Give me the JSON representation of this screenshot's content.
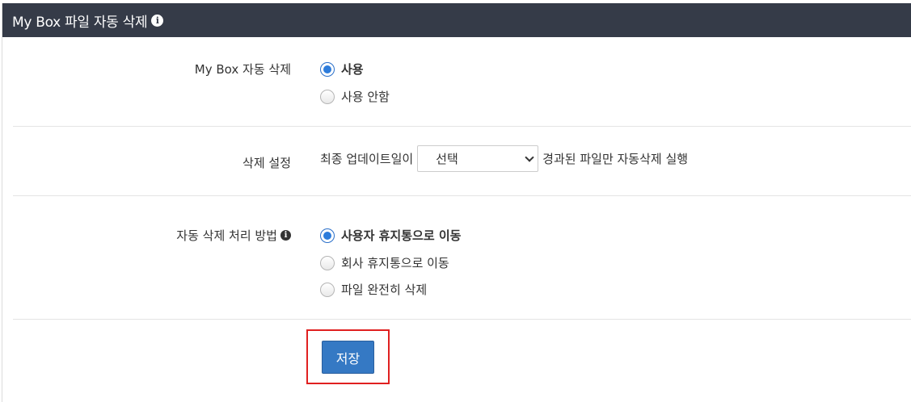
{
  "header": {
    "title": "My Box 파일 자동 삭제",
    "info_glyph": "i"
  },
  "auto_delete": {
    "label": "My Box 자동 삭제",
    "options": [
      {
        "label": "사용",
        "checked": true
      },
      {
        "label": "사용 안함",
        "checked": false
      }
    ]
  },
  "delete_setting": {
    "label": "삭제 설정",
    "prefix": "최종 업데이트일이",
    "select_value": "선택",
    "suffix": "경과된 파일만 자동삭제 실행"
  },
  "method": {
    "label": "자동 삭제 처리 방법",
    "info_glyph": "i",
    "options": [
      {
        "label": "사용자 휴지통으로 이동",
        "checked": true
      },
      {
        "label": "회사 휴지통으로 이동",
        "checked": false
      },
      {
        "label": "파일 완전히 삭제",
        "checked": false
      }
    ]
  },
  "actions": {
    "save_label": "저장"
  },
  "colors": {
    "header_bg": "#353b48",
    "accent": "#2d7cdb",
    "save_button": "#3579c4",
    "highlight": "#e02020"
  },
  "icons": {
    "header_info": "info-circle-icon",
    "method_info": "info-circle-icon",
    "select_arrow": "chevron-down-icon"
  }
}
